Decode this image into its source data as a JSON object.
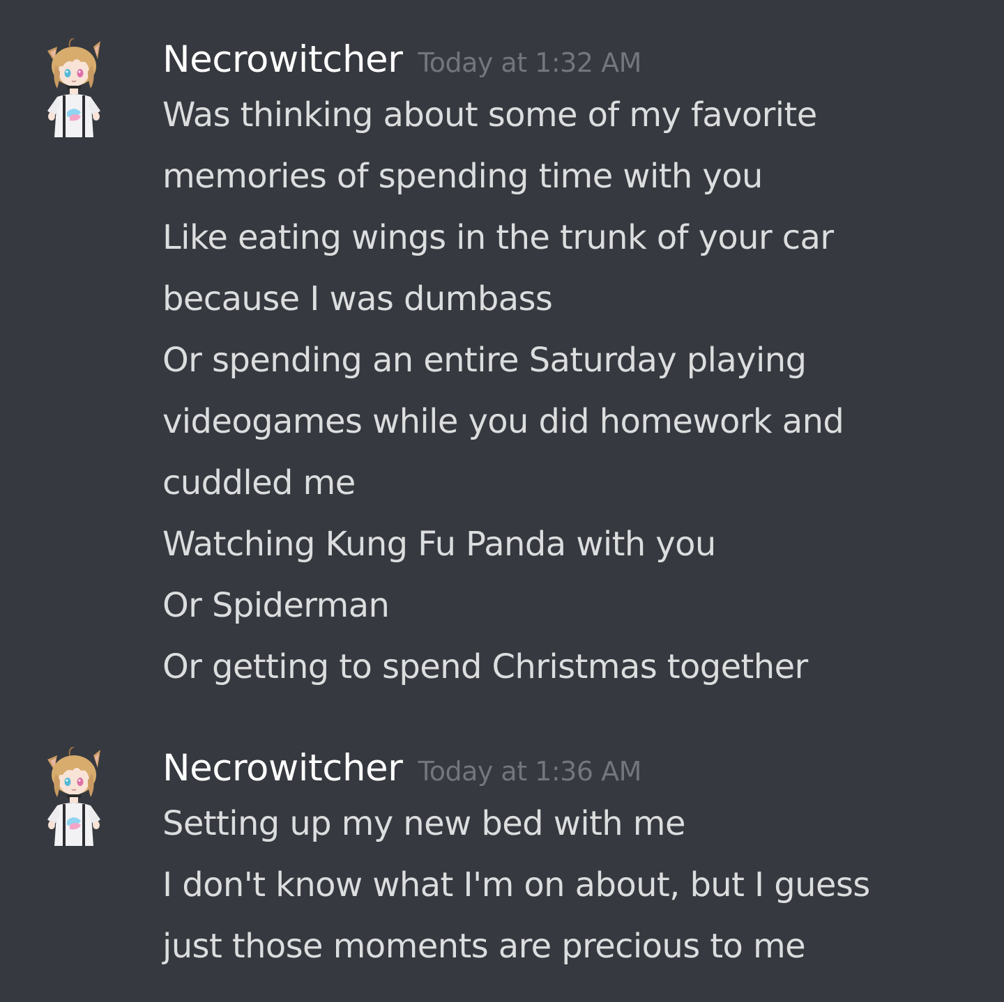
{
  "colors": {
    "background": "#36393f",
    "username": "#ffffff",
    "timestamp": "#72767d",
    "message_text": "#dcddde"
  },
  "messages": [
    {
      "avatar_icon": "anime-catgirl-avatar",
      "author": "Necrowitcher",
      "timestamp": "Today at 1:32 AM",
      "lines": [
        "Was thinking about some of my favorite",
        "memories of spending time with you",
        "Like eating wings in the trunk of your car",
        "because I was dumbass",
        "Or spending an entire Saturday playing",
        "videogames while you did homework and",
        "cuddled me",
        "Watching Kung Fu Panda with you",
        "Or Spiderman",
        "Or getting to spend Christmas together"
      ]
    },
    {
      "avatar_icon": "anime-catgirl-avatar",
      "author": "Necrowitcher",
      "timestamp": "Today at 1:36 AM",
      "lines": [
        "Setting up my new bed with me",
        "I don't know what I'm on about, but I guess",
        "just those moments are precious to me"
      ]
    }
  ]
}
